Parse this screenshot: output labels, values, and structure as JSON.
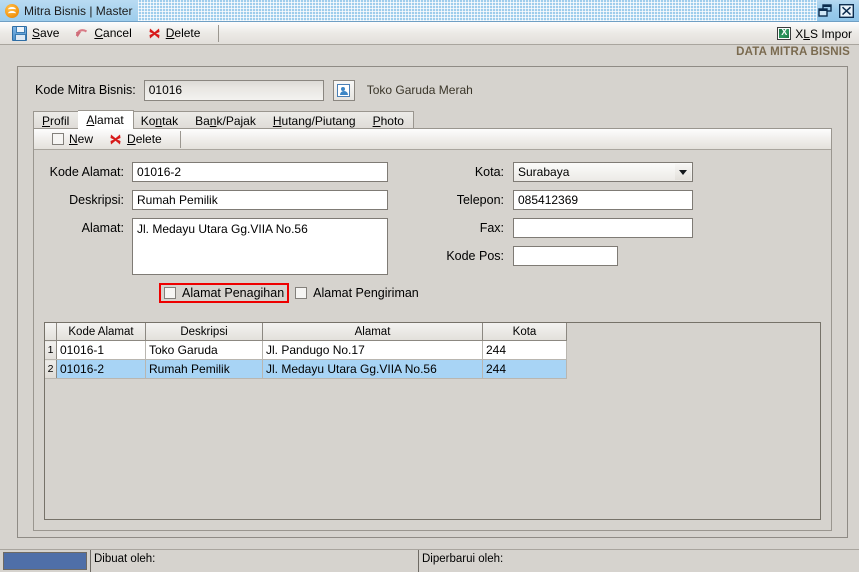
{
  "window": {
    "title": "Mitra Bisnis | Master",
    "app_icon": "app-logo-icon",
    "restore_label": "Restore",
    "close_label": "Close"
  },
  "toolbar": {
    "save": {
      "label_pre": "",
      "label_accel": "S",
      "label_post": "ave",
      "icon": "save-disk-icon"
    },
    "cancel": {
      "label_pre": "",
      "label_accel": "C",
      "label_post": "ancel",
      "icon": "undo-arrow-icon"
    },
    "delete": {
      "label_pre": "",
      "label_accel": "D",
      "label_post": "elete",
      "icon": "red-x-icon"
    },
    "xls_import": {
      "label_pre": "X",
      "label_accel": "L",
      "label_post": "S Impor",
      "icon": "excel-icon"
    }
  },
  "section": {
    "title": "DATA MITRA BISNIS"
  },
  "header": {
    "kode_label": "Kode Mitra Bisnis:",
    "kode_value": "01016",
    "lookup_icon": "contact-card-icon",
    "partner_name": "Toko Garuda Merah"
  },
  "tabs": [
    {
      "pre": "",
      "accel": "P",
      "post": "rofil",
      "active": false
    },
    {
      "pre": "",
      "accel": "A",
      "post": "lamat",
      "active": true
    },
    {
      "pre": "Ko",
      "accel": "n",
      "post": "tak",
      "active": false
    },
    {
      "pre": "Ba",
      "accel": "n",
      "post": "k/Pajak",
      "active": false
    },
    {
      "pre": "",
      "accel": "H",
      "post": "utang/Piutang",
      "active": false
    },
    {
      "pre": "",
      "accel": "P",
      "post": "hoto",
      "active": false
    }
  ],
  "inner_toolbar": {
    "new": {
      "pre": "",
      "accel": "N",
      "post": "ew",
      "icon": "new-page-icon"
    },
    "delete": {
      "pre": "",
      "accel": "D",
      "post": "elete",
      "icon": "red-x-icon"
    }
  },
  "form": {
    "kode_alamat_label": "Kode Alamat:",
    "kode_alamat_value": "01016-2",
    "deskripsi_label": "Deskripsi:",
    "deskripsi_value": "Rumah Pemilik",
    "alamat_label": "Alamat:",
    "alamat_value": "Jl. Medayu Utara Gg.VIIA No.56",
    "kota_label": "Kota:",
    "kota_value": "Surabaya",
    "telepon_label": "Telepon:",
    "telepon_value": "085412369",
    "fax_label": "Fax:",
    "fax_value": "",
    "kode_pos_label": "Kode Pos:",
    "kode_pos_value": "",
    "checkbox_penagihan": "Alamat Penagihan",
    "checkbox_pengiriman": "Alamat Pengiriman",
    "highlight_color": "#ee0000"
  },
  "table": {
    "columns": [
      "Kode Alamat",
      "Deskripsi",
      "Alamat",
      "Kota"
    ],
    "rows": [
      {
        "num": "1",
        "kode": "01016-1",
        "deskripsi": "Toko Garuda",
        "alamat": "Jl. Pandugo No.17",
        "kota": "244",
        "selected": false
      },
      {
        "num": "2",
        "kode": "01016-2",
        "deskripsi": "Rumah Pemilik",
        "alamat": "Jl. Medayu Utara Gg.VIIA No.56",
        "kota": "244",
        "selected": true
      }
    ],
    "selection_color": "#a8d4f5"
  },
  "statusbar": {
    "progress_color": "#4f6fa8",
    "created_label": "Dibuat oleh:",
    "updated_label": "Diperbarui oleh:"
  }
}
